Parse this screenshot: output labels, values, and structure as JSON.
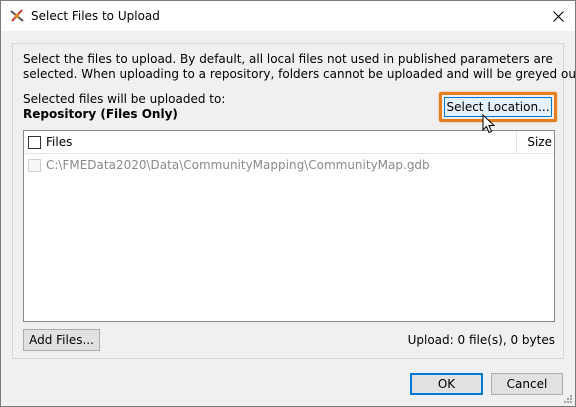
{
  "window": {
    "title": "Select Files to Upload"
  },
  "description": {
    "line1": "Select the files to upload. By default, all local files not used in published parameters are",
    "line2": "selected. When uploading to a repository, folders cannot be uploaded and will be greyed out."
  },
  "destination": {
    "label": "Selected files will be uploaded to:",
    "value": "Repository (Files Only)",
    "select_location_label": "Select Location..."
  },
  "file_list": {
    "columns": {
      "files": "Files",
      "size": "Size"
    },
    "header_checked": false,
    "rows": [
      {
        "path": "C:\\FMEData2020\\Data\\CommunityMapping\\CommunityMap.gdb",
        "size": "",
        "checked": false,
        "disabled": true
      }
    ]
  },
  "footer": {
    "add_files_label": "Add Files...",
    "upload_status": "Upload: 0 file(s), 0 bytes"
  },
  "dialog_buttons": {
    "ok_label": "OK",
    "cancel_label": "Cancel"
  },
  "colors": {
    "highlight": "#e57e1e",
    "focus": "#0078d7"
  },
  "icons": {
    "app": "fme-workbench-icon",
    "close": "close-icon",
    "cursor": "mouse-pointer-icon"
  }
}
